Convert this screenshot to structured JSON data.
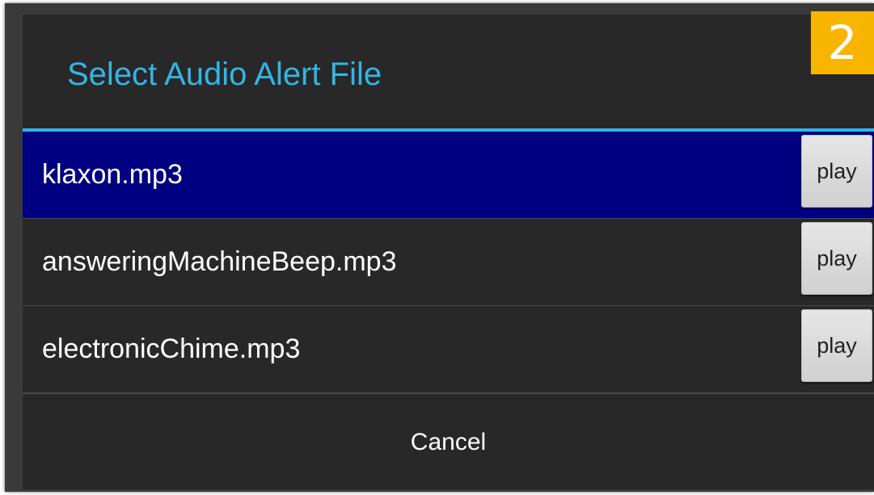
{
  "dialog": {
    "title": "Select Audio Alert File",
    "badge": "2",
    "items": [
      {
        "label": "klaxon.mp3",
        "play_label": "play",
        "selected": true
      },
      {
        "label": "answeringMachineBeep.mp3",
        "play_label": "play",
        "selected": false
      },
      {
        "label": "electronicChime.mp3",
        "play_label": "play",
        "selected": false
      }
    ],
    "cancel_label": "Cancel"
  },
  "colors": {
    "accent": "#33b5e5",
    "selected_row": "#000080",
    "dialog_bg": "#282828",
    "badge_bg": "#f7b500"
  }
}
